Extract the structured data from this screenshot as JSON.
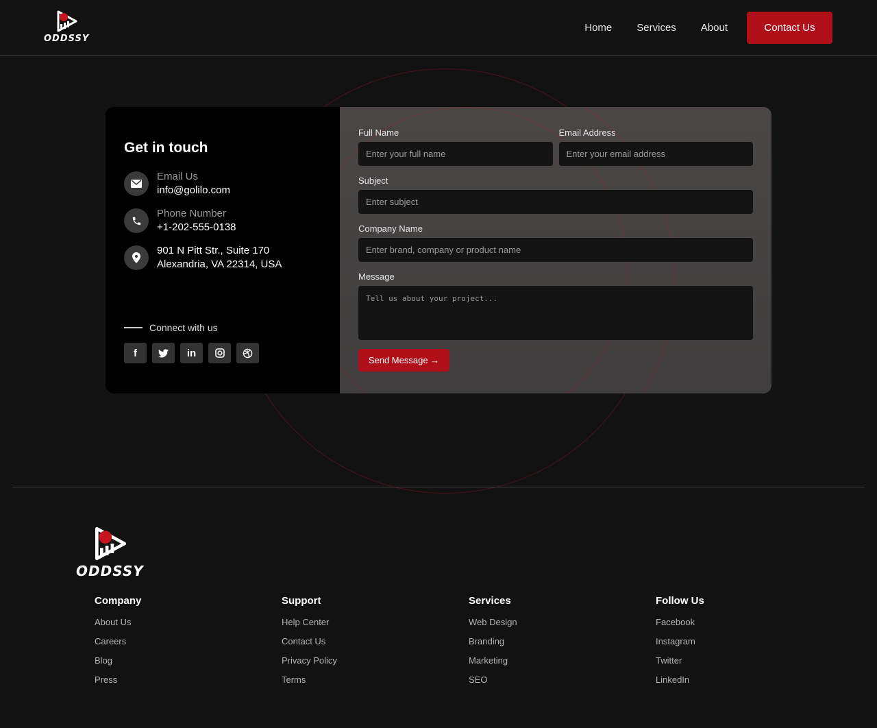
{
  "brand": {
    "name": "ODDSSY",
    "accent": "#b0101a"
  },
  "nav": {
    "items": [
      "Home",
      "Services",
      "About"
    ],
    "cta": "Contact Us"
  },
  "contact": {
    "title": "Get in touch",
    "email_label": "Email Us",
    "email": "info@golilo.com",
    "phone_label": "Phone Number",
    "phone": "+1-202-555-0138",
    "address_line1": "901 N Pitt Str., Suite 170",
    "address_line2": "Alexandria, VA 22314, USA",
    "connect": "Connect with us",
    "socials": [
      "facebook-icon",
      "twitter-icon",
      "linkedin-icon",
      "instagram-icon",
      "dribbble-icon"
    ]
  },
  "form": {
    "full_name_label": "Full Name",
    "full_name_placeholder": "Enter your full name",
    "email_label": "Email Address",
    "email_placeholder": "Enter your email address",
    "subject_label": "Subject",
    "subject_placeholder": "Enter subject",
    "company_label": "Company Name",
    "company_placeholder": "Enter brand, company or product name",
    "message_label": "Message",
    "message_placeholder": "Tell us about your project...",
    "submit": "Send Message →"
  },
  "footer": {
    "columns": [
      {
        "title": "Company",
        "links": [
          "About Us",
          "Careers",
          "Blog",
          "Press"
        ]
      },
      {
        "title": "Support",
        "links": [
          "Help Center",
          "Contact Us",
          "Privacy Policy",
          "Terms"
        ]
      },
      {
        "title": "Services",
        "links": [
          "Web Design",
          "Branding",
          "Marketing",
          "SEO"
        ]
      },
      {
        "title": "Follow Us",
        "links": [
          "Facebook",
          "Instagram",
          "Twitter",
          "LinkedIn"
        ]
      }
    ]
  }
}
